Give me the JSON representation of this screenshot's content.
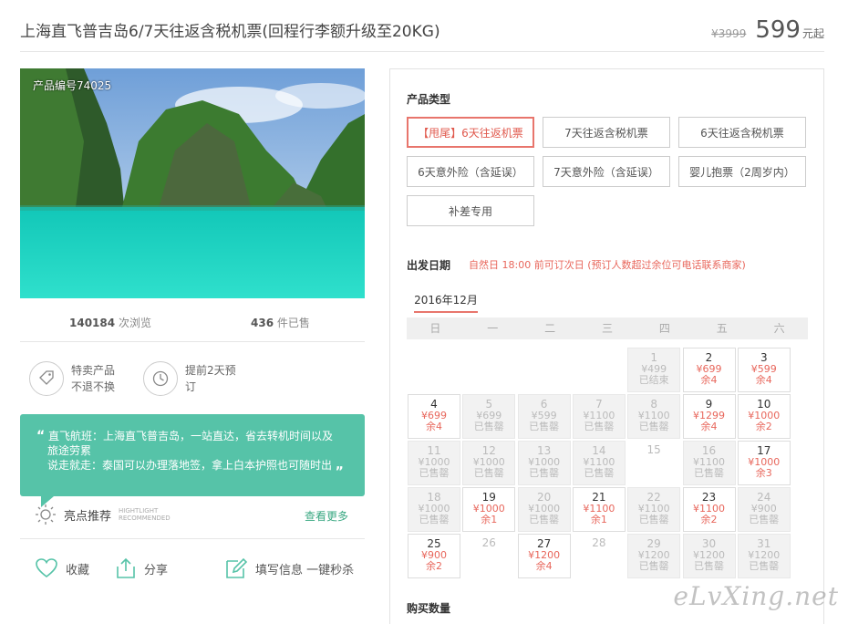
{
  "header": {
    "title": "上海直飞普吉岛6/7天往返含税机票(回程行李额升级至20KG)",
    "original_price": "¥3999",
    "price": "599",
    "price_unit": "元起"
  },
  "gallery": {
    "product_no": "产品编号74025"
  },
  "stats": {
    "views_num": "140184",
    "views_label": "次浏览",
    "sold_num": "436",
    "sold_label": "件已售"
  },
  "features": [
    {
      "icon": "tag-icon",
      "line1": "特卖产品",
      "line2": "不退不换"
    },
    {
      "icon": "clock-icon",
      "line1": "提前2天预",
      "line2": "订"
    }
  ],
  "promo": {
    "line1": "直飞航班：上海直飞普吉岛，一站直达，省去转机时间以及",
    "line2": "旅途劳累",
    "line3": "说走就走：泰国可以办理落地签，拿上白本护照也可随时出",
    "quote_open": "“",
    "quote_close": "„"
  },
  "highlight": {
    "label": "亮点推荐",
    "en1": "HIGHTLIGHT",
    "en2": "RECOMMENDED",
    "more": "查看更多"
  },
  "actions": {
    "favorite": "收藏",
    "share": "分享",
    "quick_buy": "填写信息 一键秒杀"
  },
  "booking": {
    "type_label": "产品类型",
    "types": [
      "【甩尾】6天往返机票",
      "7天往返含税机票",
      "6天往返含税机票",
      "6天意外险（含延误）",
      "7天意外险（含延误）",
      "婴儿抱票（2周岁内）",
      "补差专用"
    ],
    "date_label": "出发日期",
    "date_note": "自然日 18:00 前可订次日    (预订人数超过余位可电话联系商家)",
    "month": "2016年12月",
    "weekdays": [
      "日",
      "一",
      "二",
      "三",
      "四",
      "五",
      "六"
    ],
    "qty_label": "购买数量"
  },
  "calendar": [
    {
      "day": "1",
      "price": "¥499",
      "status": "已结束",
      "state": "past",
      "col": 4,
      "row": 0
    },
    {
      "day": "2",
      "price": "¥699",
      "status": "余4",
      "state": "avail",
      "col": 5,
      "row": 0
    },
    {
      "day": "3",
      "price": "¥599",
      "status": "余4",
      "state": "avail",
      "col": 6,
      "row": 0
    },
    {
      "day": "4",
      "price": "¥699",
      "status": "余4",
      "state": "avail",
      "col": 0,
      "row": 1
    },
    {
      "day": "5",
      "price": "¥699",
      "status": "已售罄",
      "state": "sold",
      "col": 1,
      "row": 1
    },
    {
      "day": "6",
      "price": "¥599",
      "status": "已售罄",
      "state": "sold",
      "col": 2,
      "row": 1
    },
    {
      "day": "7",
      "price": "¥1100",
      "status": "已售罄",
      "state": "sold",
      "col": 3,
      "row": 1
    },
    {
      "day": "8",
      "price": "¥1100",
      "status": "已售罄",
      "state": "sold",
      "col": 4,
      "row": 1
    },
    {
      "day": "9",
      "price": "¥1299",
      "status": "余4",
      "state": "avail",
      "col": 5,
      "row": 1
    },
    {
      "day": "10",
      "price": "¥1000",
      "status": "余2",
      "state": "avail",
      "col": 6,
      "row": 1
    },
    {
      "day": "11",
      "price": "¥1000",
      "status": "已售罄",
      "state": "sold",
      "col": 0,
      "row": 2
    },
    {
      "day": "12",
      "price": "¥1000",
      "status": "已售罄",
      "state": "sold",
      "col": 1,
      "row": 2
    },
    {
      "day": "13",
      "price": "¥1000",
      "status": "已售罄",
      "state": "sold",
      "col": 2,
      "row": 2
    },
    {
      "day": "14",
      "price": "¥1100",
      "status": "已售罄",
      "state": "sold",
      "col": 3,
      "row": 2
    },
    {
      "day": "15",
      "price": "",
      "status": "",
      "state": "empty",
      "col": 4,
      "row": 2
    },
    {
      "day": "16",
      "price": "¥1100",
      "status": "已售罄",
      "state": "sold",
      "col": 5,
      "row": 2
    },
    {
      "day": "17",
      "price": "¥1000",
      "status": "余3",
      "state": "avail",
      "col": 6,
      "row": 2
    },
    {
      "day": "18",
      "price": "¥1000",
      "status": "已售罄",
      "state": "sold",
      "col": 0,
      "row": 3
    },
    {
      "day": "19",
      "price": "¥1000",
      "status": "余1",
      "state": "avail",
      "col": 1,
      "row": 3
    },
    {
      "day": "20",
      "price": "¥1000",
      "status": "已售罄",
      "state": "sold",
      "col": 2,
      "row": 3
    },
    {
      "day": "21",
      "price": "¥1100",
      "status": "余1",
      "state": "avail",
      "col": 3,
      "row": 3
    },
    {
      "day": "22",
      "price": "¥1100",
      "status": "已售罄",
      "state": "sold",
      "col": 4,
      "row": 3
    },
    {
      "day": "23",
      "price": "¥1100",
      "status": "余2",
      "state": "avail",
      "col": 5,
      "row": 3
    },
    {
      "day": "24",
      "price": "¥900",
      "status": "已售罄",
      "state": "sold",
      "col": 6,
      "row": 3
    },
    {
      "day": "25",
      "price": "¥900",
      "status": "余2",
      "state": "avail",
      "col": 0,
      "row": 4
    },
    {
      "day": "26",
      "price": "",
      "status": "",
      "state": "empty",
      "col": 1,
      "row": 4
    },
    {
      "day": "27",
      "price": "¥1200",
      "status": "余4",
      "state": "avail",
      "col": 2,
      "row": 4
    },
    {
      "day": "28",
      "price": "",
      "status": "",
      "state": "empty",
      "col": 3,
      "row": 4
    },
    {
      "day": "29",
      "price": "¥1200",
      "status": "已售罄",
      "state": "sold",
      "col": 4,
      "row": 4
    },
    {
      "day": "30",
      "price": "¥1200",
      "status": "已售罄",
      "state": "sold",
      "col": 5,
      "row": 4
    },
    {
      "day": "31",
      "price": "¥1200",
      "status": "已售罄",
      "state": "sold",
      "col": 6,
      "row": 4
    }
  ],
  "watermark": "eLvXing.net",
  "colors": {
    "accent": "#e8675c",
    "green": "#56c3a8",
    "link": "#3aa882"
  }
}
